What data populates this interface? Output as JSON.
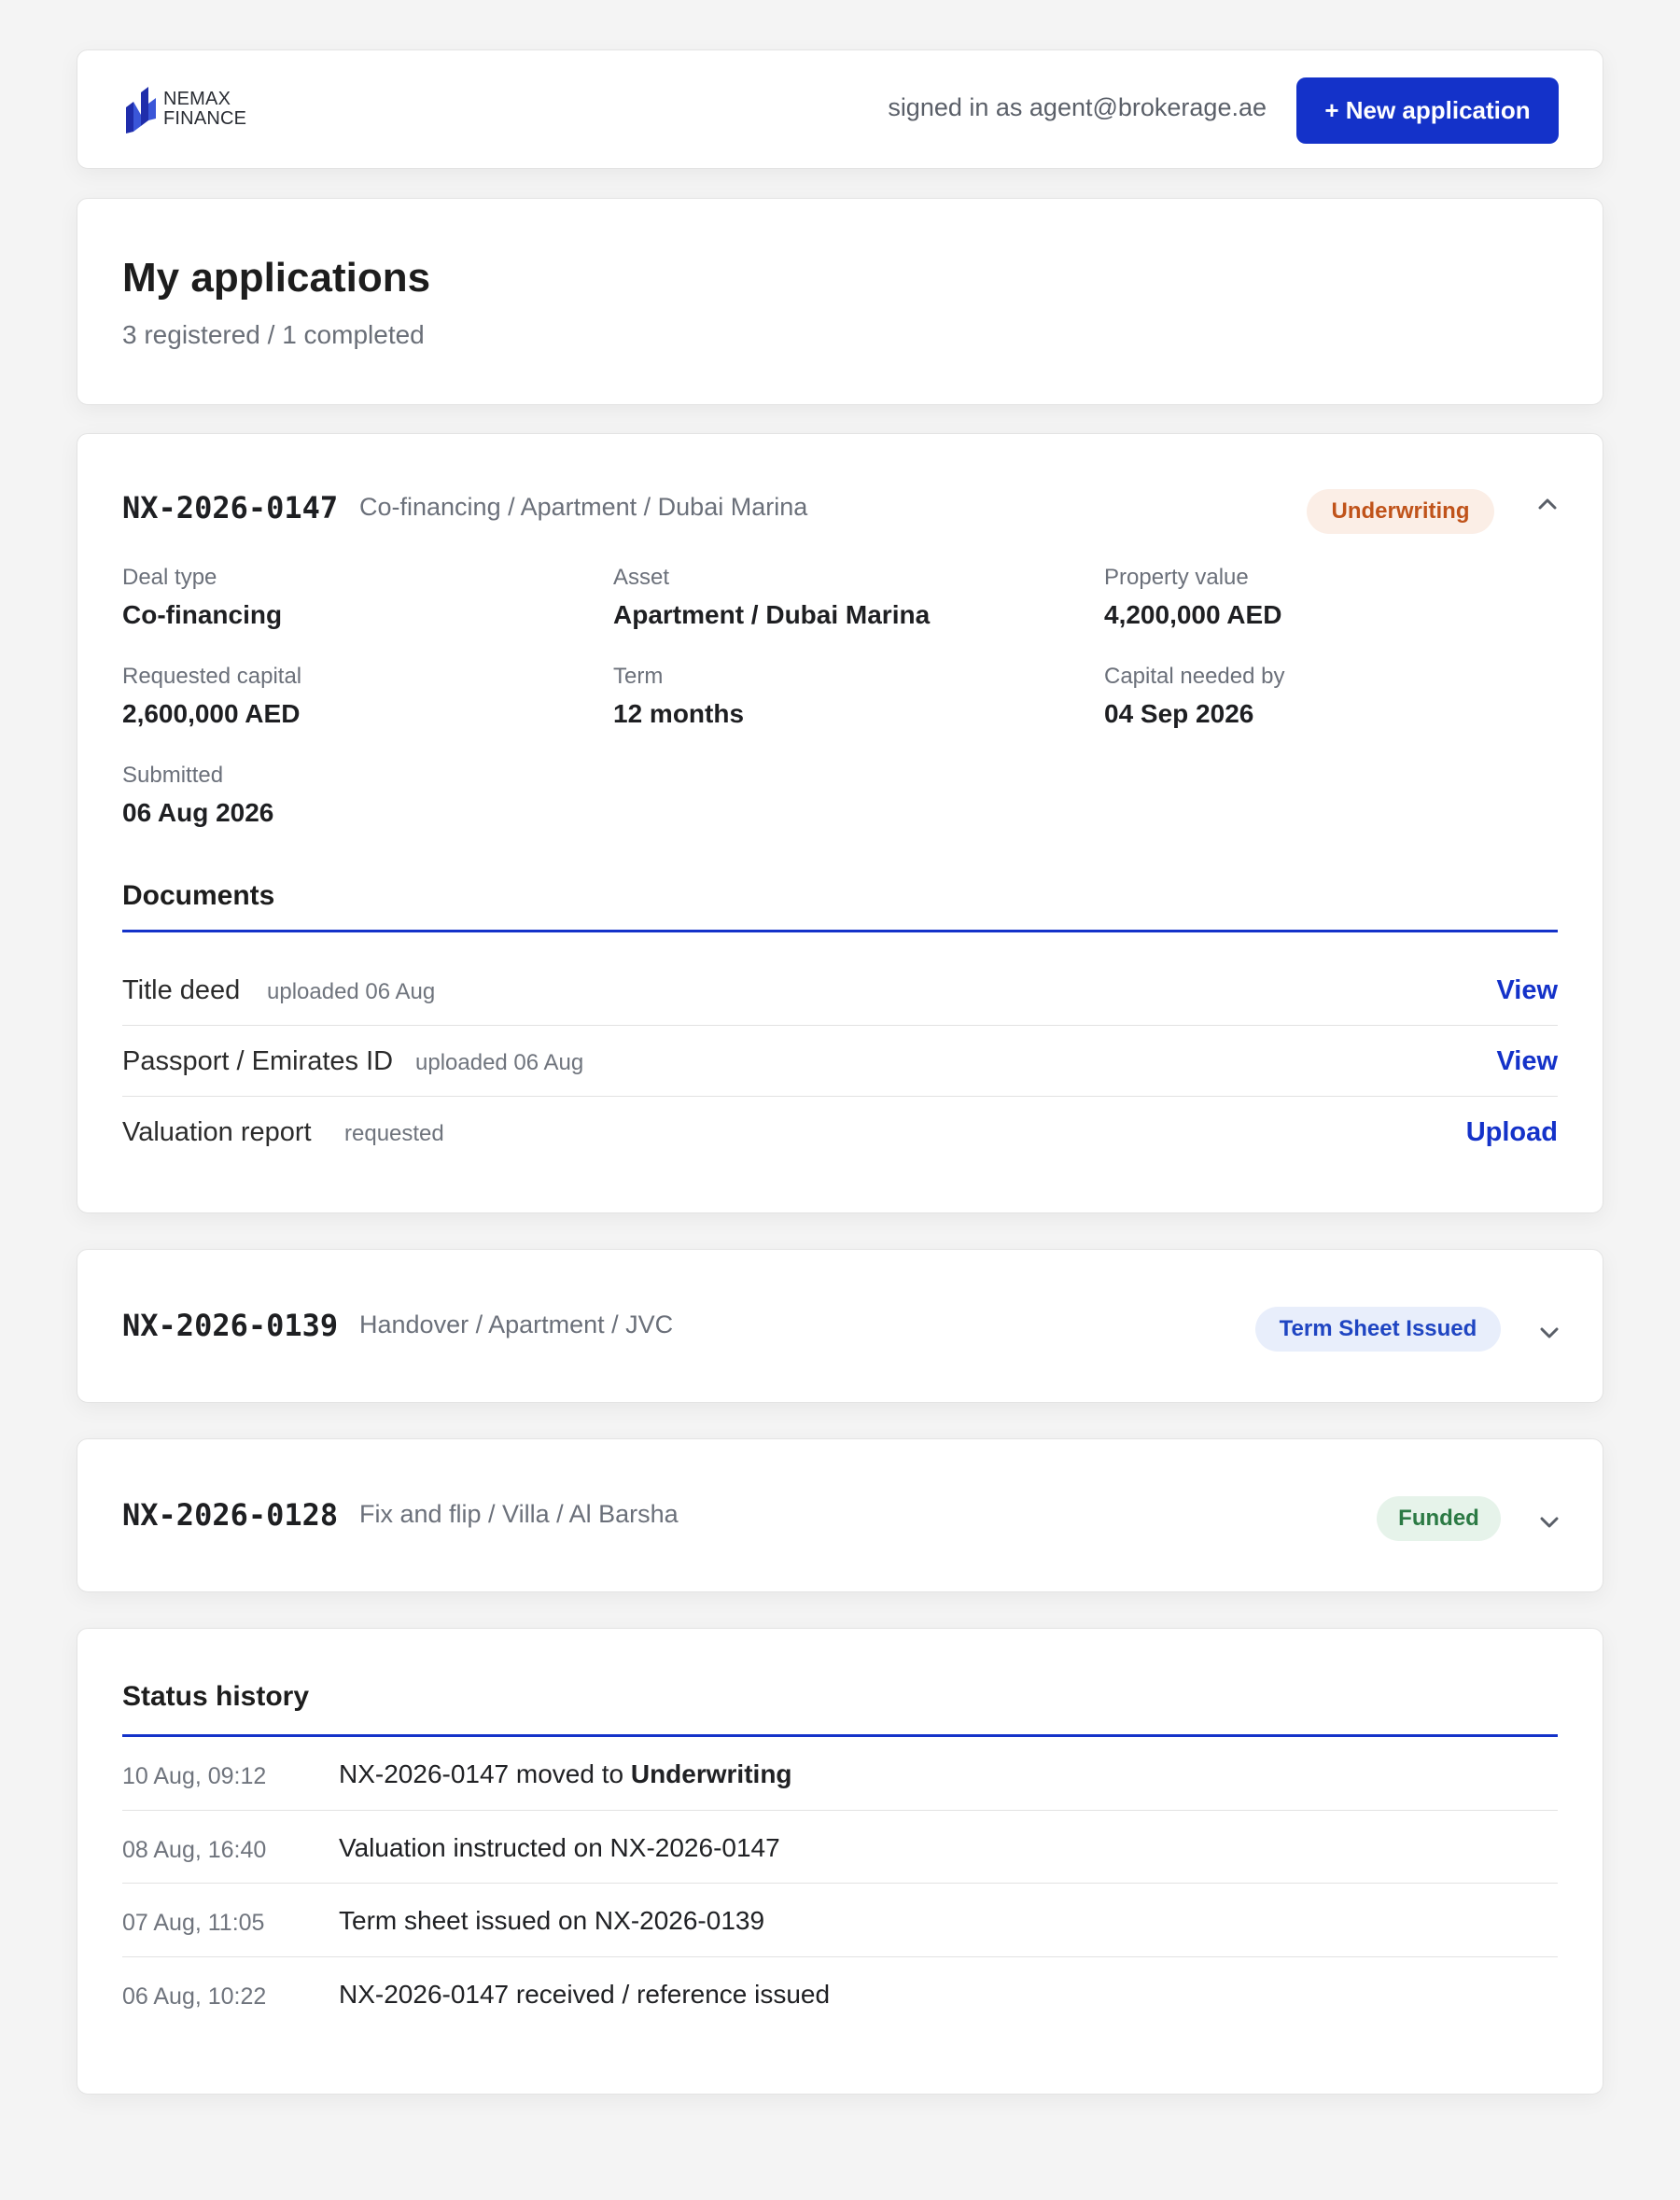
{
  "header": {
    "logo_line1": "NEMAX",
    "logo_line2": "FINANCE",
    "signed_in": "signed in as agent@brokerage.ae",
    "new_application": "+ New application"
  },
  "title": {
    "heading": "My applications",
    "summary": "3 registered / 1 completed"
  },
  "applications": [
    {
      "id": "NX-2026-0147",
      "description": "Co-financing / Apartment / Dubai Marina",
      "status": "Underwriting",
      "expanded": true,
      "fields": [
        {
          "label": "Deal type",
          "value": "Co-financing"
        },
        {
          "label": "Asset",
          "value": "Apartment / Dubai Marina"
        },
        {
          "label": "Property value",
          "value": "4,200,000 AED"
        },
        {
          "label": "Requested capital",
          "value": "2,600,000 AED"
        },
        {
          "label": "Term",
          "value": "12 months"
        },
        {
          "label": "Capital needed by",
          "value": "04 Sep 2026"
        },
        {
          "label": "Submitted",
          "value": "06 Aug 2026"
        }
      ],
      "documents_title": "Documents",
      "documents": [
        {
          "name": "Title deed",
          "status": "uploaded 06 Aug",
          "action": "View"
        },
        {
          "name": "Passport / Emirates ID",
          "status": "uploaded 06 Aug",
          "action": "View"
        },
        {
          "name": "Valuation report",
          "status": "requested",
          "action": "Upload"
        }
      ]
    },
    {
      "id": "NX-2026-0139",
      "description": "Handover / Apartment / JVC",
      "status": "Term Sheet Issued",
      "expanded": false
    },
    {
      "id": "NX-2026-0128",
      "description": "Fix and flip / Villa / Al Barsha",
      "status": "Funded",
      "expanded": false
    }
  ],
  "history": {
    "title": "Status history",
    "entries": [
      {
        "time": "10 Aug, 09:12",
        "text_before": "NX-2026-0147 moved to ",
        "text_bold": "Underwriting"
      },
      {
        "time": "08 Aug, 16:40",
        "text": "Valuation instructed on NX-2026-0147"
      },
      {
        "time": "07 Aug, 11:05",
        "text": "Term sheet issued on NX-2026-0139"
      },
      {
        "time": "06 Aug, 10:22",
        "text": "NX-2026-0147 received / reference issued"
      }
    ]
  },
  "colors": {
    "accent": "#1432c9",
    "underwriting_bg": "#fbeee6",
    "underwriting_fg": "#c0531a",
    "term_sheet_bg": "#e8eefb",
    "term_sheet_fg": "#1f45c2",
    "funded_bg": "#e6f3ea",
    "funded_fg": "#2b7a44"
  }
}
